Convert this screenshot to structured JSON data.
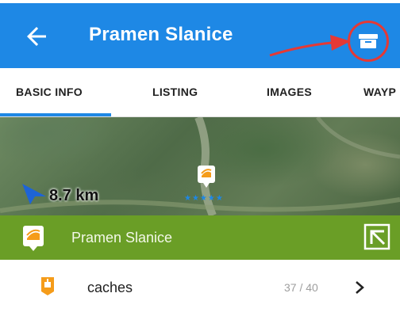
{
  "appbar": {
    "title": "Pramen Slanice",
    "back_icon": "arrow-left-icon",
    "action_icon": "box-icon",
    "color": "#1e88e5",
    "annotation_color": "#e53935"
  },
  "tabs": [
    {
      "label": "BASIC INFO",
      "active": true
    },
    {
      "label": "LISTING",
      "active": false
    },
    {
      "label": "IMAGES",
      "active": false
    },
    {
      "label": "WAYP",
      "active": false
    }
  ],
  "map": {
    "distance": "8.7 km",
    "stars": "★★★★★",
    "marker_icon": "geocache-marker-icon",
    "nav_icon": "navigation-arrow-icon"
  },
  "point": {
    "title": "Pramen Slanice",
    "color": "#6a9e26",
    "expand_icon": "expand-arrow-icon"
  },
  "row": {
    "label": "caches",
    "count": "37 / 40",
    "icon": "caches-icon",
    "chevron_icon": "chevron-right-icon"
  }
}
